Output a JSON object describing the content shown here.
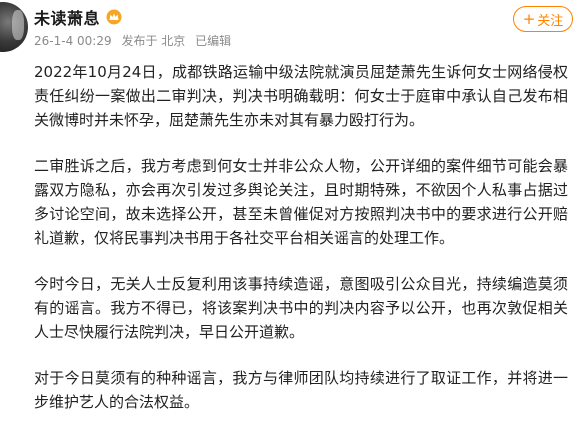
{
  "post": {
    "username": "未读萧息",
    "date": "26-1-4 00:29",
    "source": "发布于 北京",
    "edited": "已编辑",
    "follow_label": "关注",
    "paragraphs": [
      "2022年10月24日，成都铁路运输中级法院就演员屈楚萧先生诉何女士网络侵权责任纠纷一案做出二审判决，判决书明确载明：何女士于庭审中承认自己发布相关微博时并未怀孕，屈楚萧先生亦未对其有暴力殴打行为。",
      "二审胜诉之后，我方考虑到何女士并非公众人物，公开详细的案件细节可能会暴露双方隐私，亦会再次引发过多舆论关注，且时期特殊，不欲因个人私事占据过多讨论空间，故未选择公开，甚至未曾催促对方按照判决书中的要求进行公开赔礼道歉，仅将民事判决书用于各社交平台相关谣言的处理工作。",
      "今时今日，无关人士反复利用该事持续造谣，意图吸引公众目光，持续编造莫须有的谣言。我方不得已，将该案判决书中的判决内容予以公开，也再次敦促相关人士尽快履行法院判决，早日公开道歉。",
      "对于今日莫须有的种种谣言，我方与律师团队均持续进行了取证工作，并将进一步维护艺人的合法权益。"
    ]
  },
  "icons": {
    "vip": "crown-badge-icon",
    "follow": "plus-icon"
  },
  "colors": {
    "accent": "#ff8200",
    "meta_text": "#8a8a8a",
    "body_text": "#222222"
  }
}
